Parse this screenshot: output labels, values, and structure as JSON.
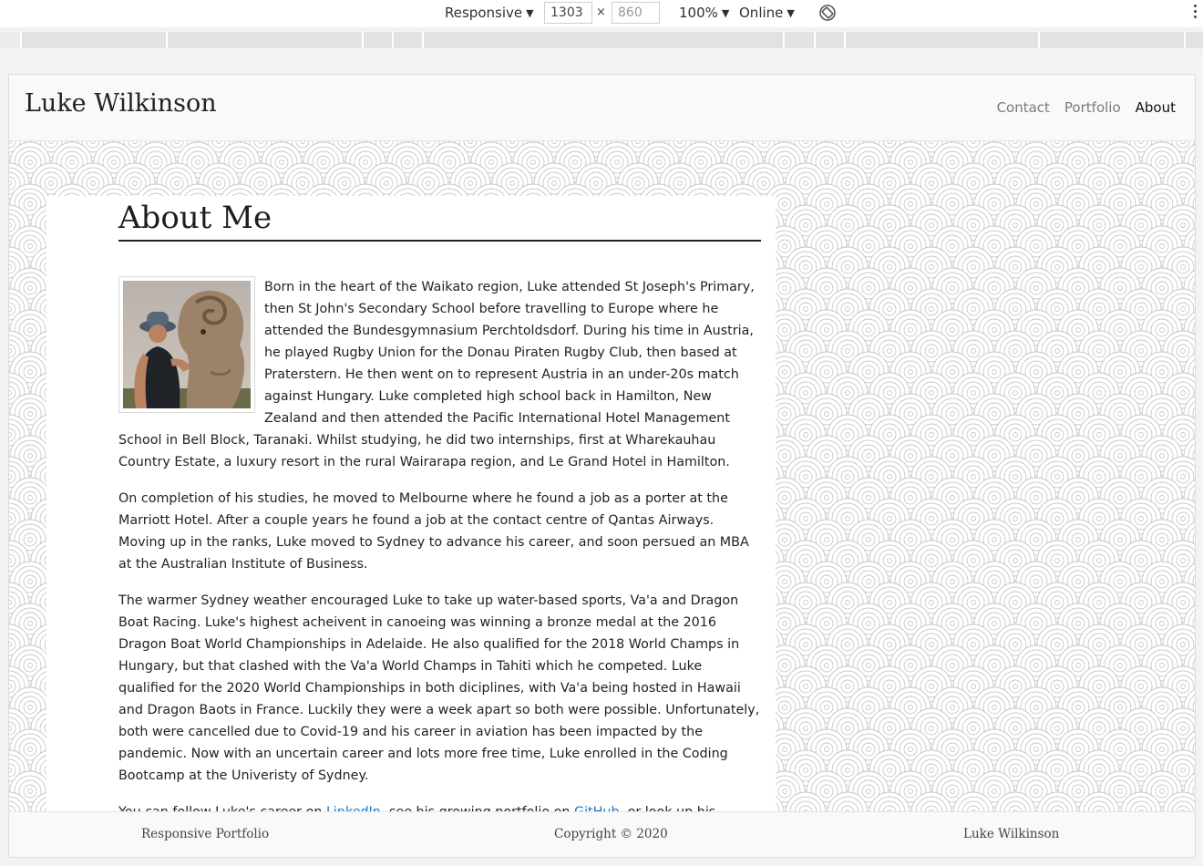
{
  "devtools": {
    "device": "Responsive",
    "width": "1303",
    "height": "860",
    "times": "×",
    "zoom": "100%",
    "network": "Online",
    "caret": "▼",
    "icons": [
      "rotate-icon",
      "more-options-icon"
    ]
  },
  "navbar": {
    "brand": "Luke Wilkinson",
    "links": [
      "Contact",
      "Portfolio",
      "About"
    ],
    "active": "About"
  },
  "main": {
    "heading": "About Me",
    "photo_name": "profile-photo",
    "p1": "Born in the heart of the Waikato region, Luke attended St Joseph's Primary, then St John's Secondary School before travelling to Europe where he attended the Bundesgymnasium Perchtoldsdorf. During his time in Austria, he played Rugby Union for the Donau Piraten Rugby Club, then based at Praterstern. He then went on to represent Austria in an under-20s match against Hungary. Luke completed high school back in Hamilton, New Zealand and then attended the Pacific International Hotel Management School in Bell Block, Taranaki. Whilst studying, he did two internships, first at Wharekauhau Country Estate, a luxury resort in the rural Wairarapa region, and Le Grand Hotel in Hamilton.",
    "p2": "On completion of his studies, he moved to Melbourne where he found a job as a porter at the Marriott Hotel. After a couple years he found a job at the contact centre of Qantas Airways. Moving up in the ranks, Luke moved to Sydney to advance his career, and soon persued an MBA at the Australian Institute of Business.",
    "p3": "The warmer Sydney weather encouraged Luke to take up water-based sports, Va'a and Dragon Boat Racing. Luke's highest acheivent in canoeing was winning a bronze medal at the 2016 Dragon Boat World Championships in Adelaide. He also qualified for the 2018 World Champs in Hungary, but that clashed with the Va'a World Champs in Tahiti which he competed. Luke qualified for the 2020 World Championships in both diciplines, with Va'a being hosted in Hawaii and Dragon Baots in France. Luckily they were a week apart so both were possible. Unfortunately, both were cancelled due to Covid-19 and his career in aviation has been impacted by the pandemic. Now with an uncertain career and lots more free time, Luke enrolled in the Coding Bootcamp at the Univeristy of Sydney.",
    "p4_a": "You can follow Luke's career on ",
    "p4_link1": "LinkedIn",
    "p4_b": ", see his growing portfolio on ",
    "p4_link2": "GitHub",
    "p4_c": ", or look up his"
  },
  "footer": {
    "left": "Responsive Portfolio",
    "center": "Copyright © 2020",
    "right": "Luke Wilkinson"
  },
  "colors": {
    "link": "#1e73be",
    "navbar_bg": "#f8f9fa",
    "nav_inactive": "#7a7a7a"
  }
}
